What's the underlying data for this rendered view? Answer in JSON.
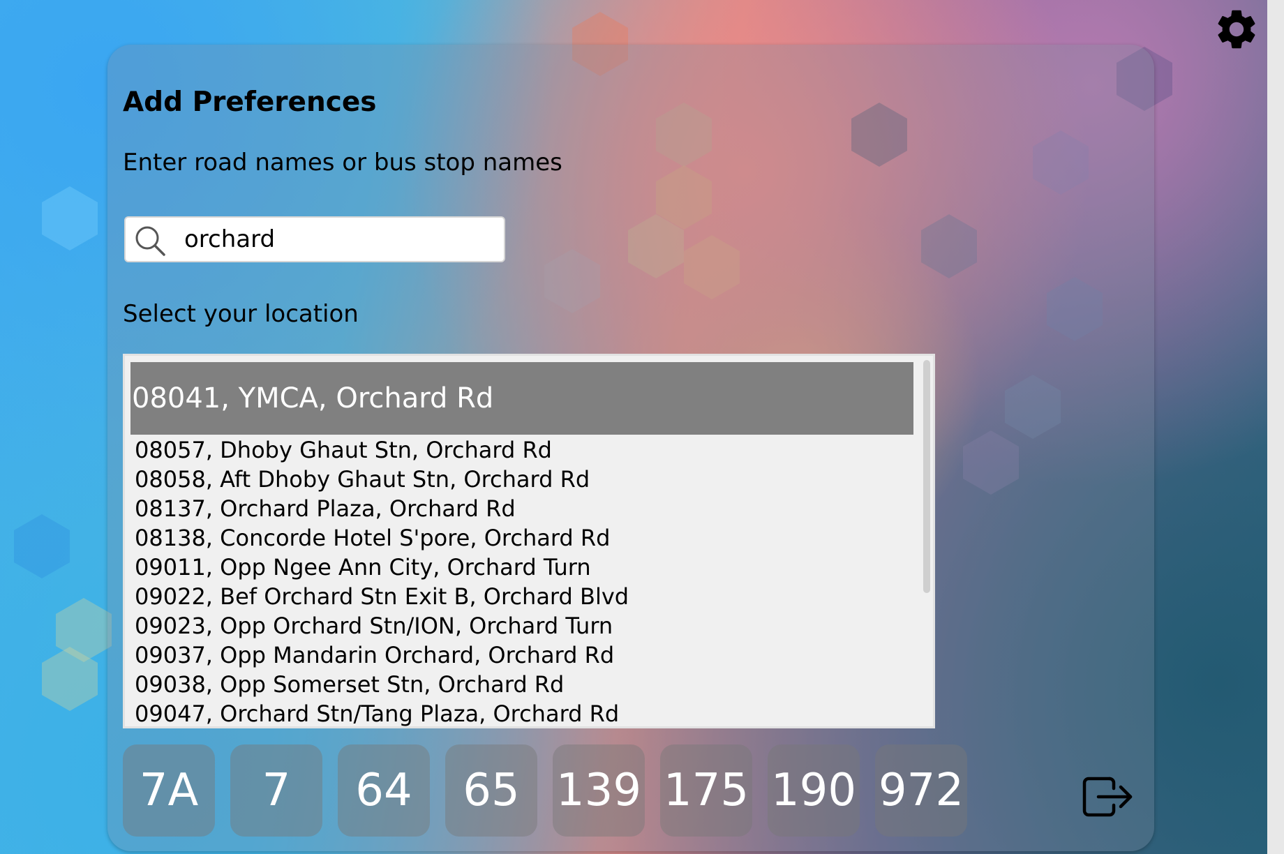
{
  "colors": {
    "panel_bg": "rgba(130,140,160,0.30)",
    "selected_bg": "#808080",
    "list_bg": "#f0f0f0",
    "route_bg": "rgba(120,120,120,0.45)"
  },
  "header": {
    "settings_icon": "gear-icon"
  },
  "preferences": {
    "title": "Add Preferences",
    "search_label": "Enter road names or bus stop names",
    "search": {
      "value": "orchard",
      "icon": "search-icon"
    },
    "location_label": "Select your location",
    "locations": {
      "selected": "08041, YMCA, Orchard Rd",
      "items": [
        "08057, Dhoby Ghaut Stn, Orchard Rd",
        "08058, Aft Dhoby Ghaut Stn, Orchard Rd",
        "08137, Orchard Plaza, Orchard Rd",
        "08138, Concorde Hotel S'pore, Orchard Rd",
        "09011, Opp Ngee Ann City, Orchard Turn",
        "09022, Bef Orchard Stn Exit B, Orchard Blvd",
        "09023, Opp Orchard Stn/ION, Orchard Turn",
        "09037, Opp Mandarin Orchard, Orchard Rd",
        "09038, Opp Somerset Stn, Orchard Rd",
        "09047, Orchard Stn/Tang Plaza, Orchard Rd"
      ]
    },
    "routes": [
      "7A",
      "7",
      "64",
      "65",
      "139",
      "175",
      "190",
      "972"
    ],
    "logout_icon": "logout-icon"
  }
}
